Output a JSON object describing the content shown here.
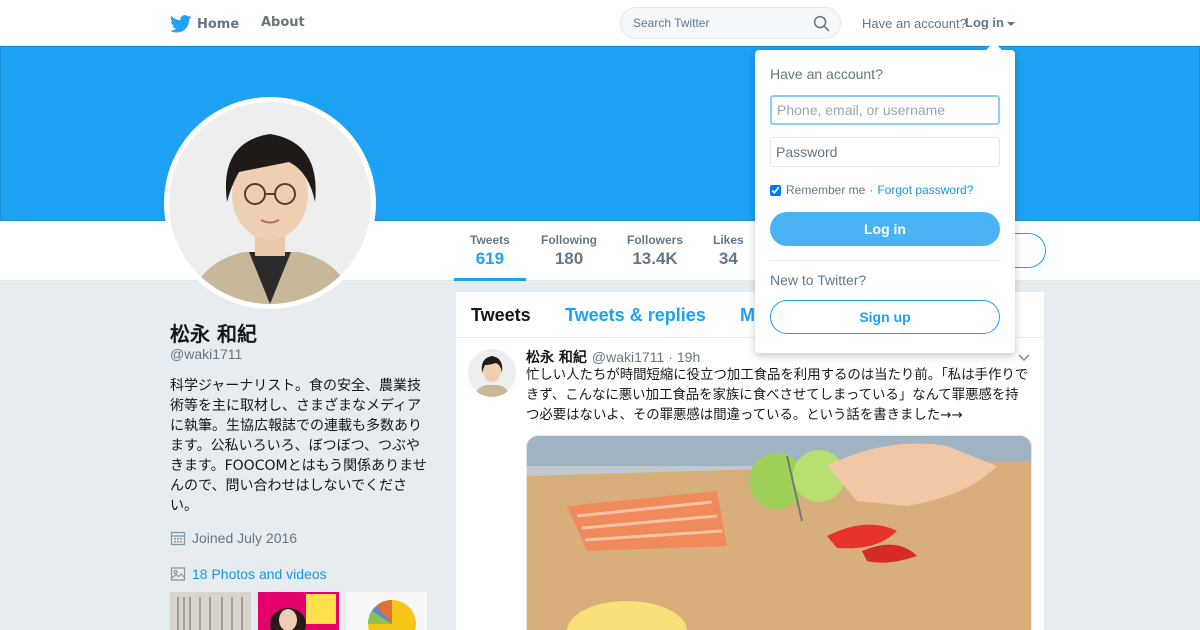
{
  "topnav": {
    "home_label": "Home",
    "about_label": "About",
    "search_placeholder": "Search Twitter",
    "account_prompt": "Have an account?",
    "login_label": "Log in",
    "icons": [
      "twitter-bird-icon",
      "search-icon",
      "caret-down-icon"
    ]
  },
  "profile": {
    "name": "松永 和紀",
    "handle": "@waki1711",
    "bio": "科学ジャーナリスト。食の安全、農業技術等を主に取材し、さまざまなメディアに執筆。生協広報誌での連載も多数あります。公私いろいろ、ぼつぼつ、つぶやきます。FOOCOMとはもう関係ありませんので、問い合わせはしないでください。",
    "joined": "Joined July 2016",
    "photos_link": "18 Photos and videos"
  },
  "stats": [
    {
      "label": "Tweets",
      "value": "619"
    },
    {
      "label": "Following",
      "value": "180"
    },
    {
      "label": "Followers",
      "value": "13.4K"
    },
    {
      "label": "Likes",
      "value": "34"
    }
  ],
  "timeline": {
    "tabs": [
      "Tweets",
      "Tweets & replies",
      "M"
    ]
  },
  "tweet": {
    "name": "松永 和紀",
    "handle": "@waki1711",
    "dot": "·",
    "time": "19h",
    "text": "忙しい人たちが時間短縮に役立つ加工食品を利用するのは当たり前。「私は手作りできず、こんなに悪い加工食品を家族に食べさせてしまっている」なんて罪悪感を持つ必要はないよ、その罪悪感は間違っている。という話を書きました→→"
  },
  "login_dropdown": {
    "title": "Have an account?",
    "username_placeholder": "Phone, email, or username",
    "password_placeholder": "Password",
    "remember_label": "Remember me",
    "separator": "·",
    "forgot_label": "Forgot password?",
    "login_button": "Log in",
    "new_prompt": "New to Twitter?",
    "signup_button": "Sign up"
  },
  "colors": {
    "brand_blue": "#1da1f2",
    "link_blue": "#1b95e0",
    "login_button": "#4ab3f4",
    "page_bg": "#e6ecf0"
  }
}
